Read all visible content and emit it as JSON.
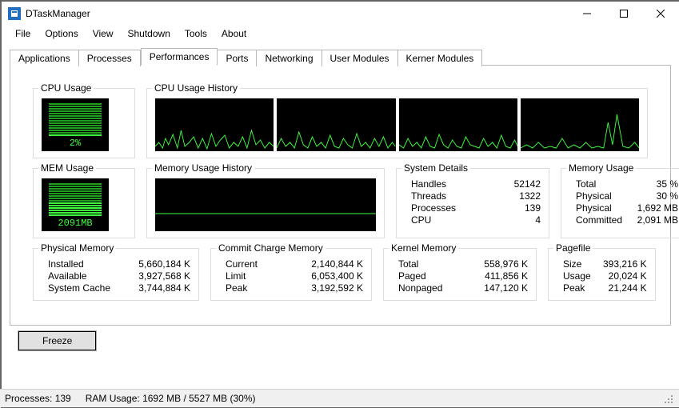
{
  "window": {
    "title": "DTaskManager"
  },
  "menu": {
    "file": "File",
    "options": "Options",
    "view": "View",
    "shutdown": "Shutdown",
    "tools": "Tools",
    "about": "About"
  },
  "tabs": {
    "applications": "Applications",
    "processes": "Processes",
    "performances": "Performances",
    "ports": "Ports",
    "networking": "Networking",
    "user_modules": "User Modules",
    "kerner_modules": "Kerner Modules"
  },
  "groups": {
    "cpu_usage": "CPU Usage",
    "cpu_hist": "CPU Usage History",
    "mem_usage": "MEM Usage",
    "mem_hist": "Memory Usage History",
    "sys_details": "System Details",
    "memory_usage": "Memory Usage",
    "phys_mem": "Physical Memory",
    "commit": "Commit Charge Memory",
    "kernel": "Kernel Memory",
    "pagefile": "Pagefile"
  },
  "gauge": {
    "cpu": "2%",
    "mem": "2091MB"
  },
  "sys_details": {
    "handles_k": "Handles",
    "handles_v": "52142",
    "threads_k": "Threads",
    "threads_v": "1322",
    "processes_k": "Processes",
    "processes_v": "139",
    "cpu_k": "CPU",
    "cpu_v": "4"
  },
  "memory_usage": {
    "total_k": "Total",
    "total_v": "35 %",
    "physical_k": "Physical",
    "physical_v": "30 %",
    "physical2_k": "Physical",
    "physical2_v": "1,692 MB",
    "committed_k": "Committed",
    "committed_v": "2,091 MB"
  },
  "phys_mem": {
    "installed_k": "Installed",
    "installed_v": "5,660,184 K",
    "available_k": "Available",
    "available_v": "3,927,568 K",
    "cache_k": "System Cache",
    "cache_v": "3,744,884 K"
  },
  "commit": {
    "current_k": "Current",
    "current_v": "2,140,844 K",
    "limit_k": "Limit",
    "limit_v": "6,053,400 K",
    "peak_k": "Peak",
    "peak_v": "3,192,592 K"
  },
  "kernel": {
    "total_k": "Total",
    "total_v": "558,976 K",
    "paged_k": "Paged",
    "paged_v": "411,856 K",
    "nonpaged_k": "Nonpaged",
    "nonpaged_v": "147,120 K"
  },
  "pagefile": {
    "size_k": "Size",
    "size_v": "393,216 K",
    "usage_k": "Usage",
    "usage_v": "20,024 K",
    "peak_k": "Peak",
    "peak_v": "21,244 K"
  },
  "buttons": {
    "freeze": "Freeze"
  },
  "status": {
    "proc": "Processes: 139",
    "ram": "RAM Usage:  1692 MB / 5527 MB (30%)"
  },
  "chart_data": [
    {
      "type": "line",
      "title": "CPU Usage History",
      "series_count": 4,
      "ylim": [
        0,
        100
      ],
      "note": "four per-core sparklines, values fluctuate roughly 0–40%"
    },
    {
      "type": "line",
      "title": "Memory Usage History",
      "ylim": [
        0,
        6000
      ],
      "approx_value": 2091,
      "unit": "MB",
      "note": "flat line near 2091 MB"
    }
  ]
}
